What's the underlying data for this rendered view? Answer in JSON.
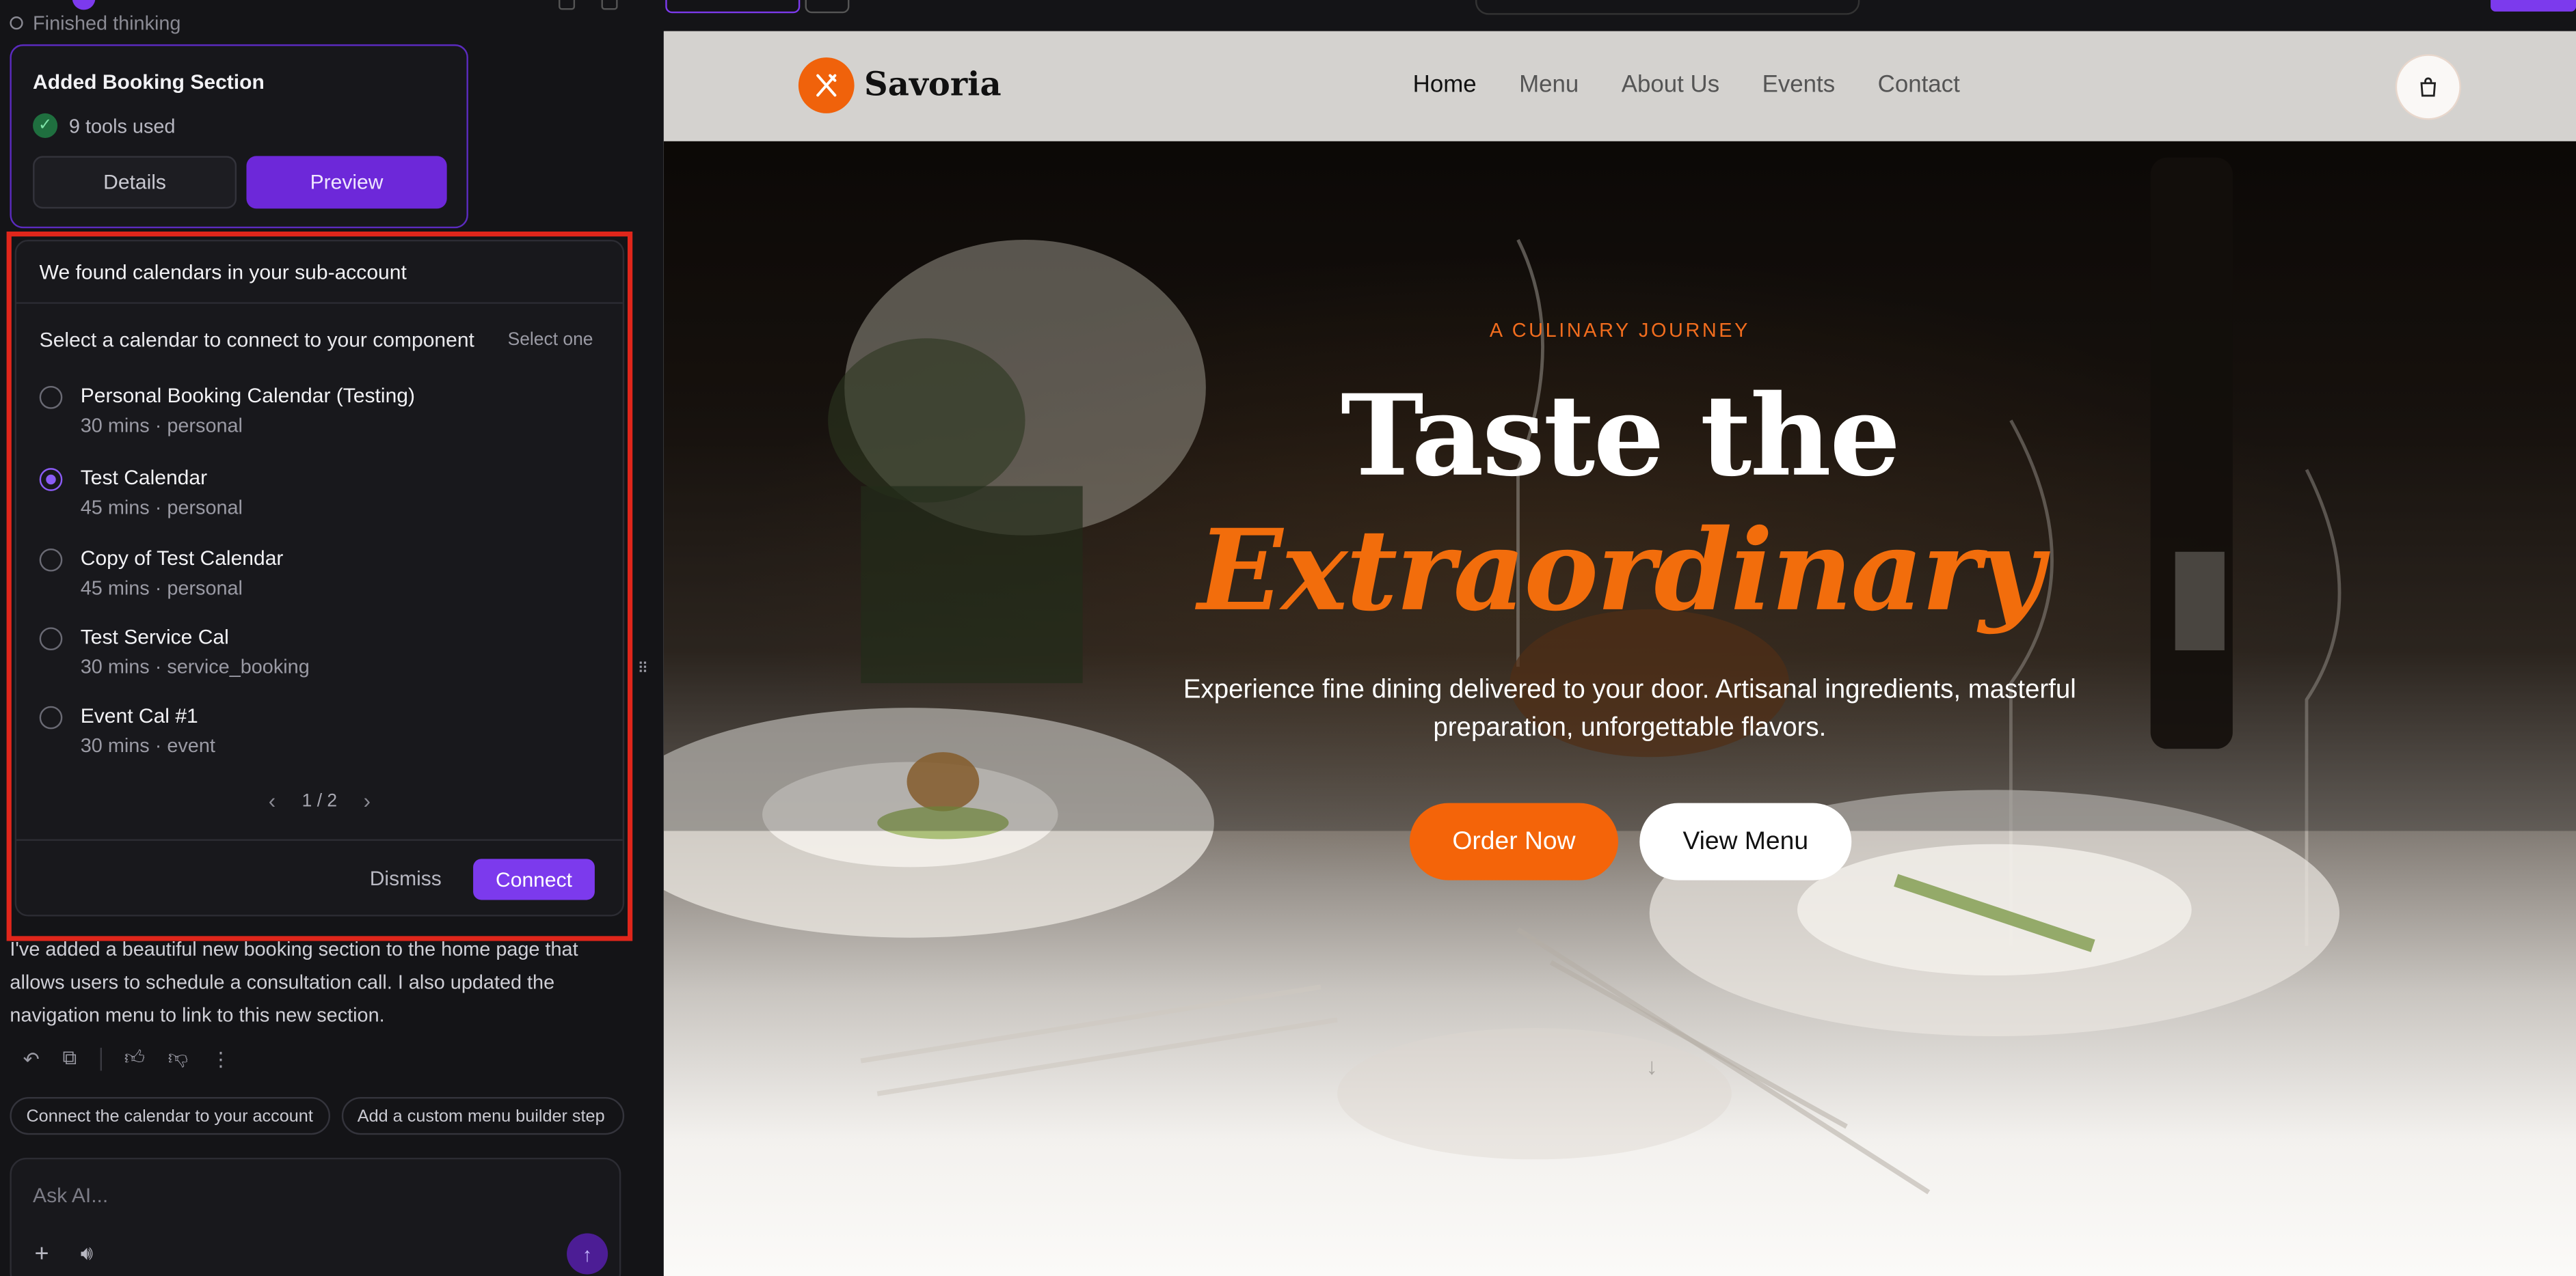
{
  "left": {
    "finished_thinking": "Finished thinking",
    "step": {
      "title": "Added Booking Section",
      "tools": "9 tools used",
      "details": "Details",
      "preview": "Preview"
    },
    "calendar": {
      "header": "We found calendars in your sub-account",
      "subtitle": "Select a calendar to connect to your component",
      "select_hint": "Select one",
      "items": [
        {
          "name": "Personal Booking Calendar (Testing)",
          "meta": "30 mins · personal",
          "selected": false
        },
        {
          "name": "Test Calendar",
          "meta": "45 mins · personal",
          "selected": true
        },
        {
          "name": "Copy of Test Calendar",
          "meta": "45 mins · personal",
          "selected": false
        },
        {
          "name": "Test Service Cal",
          "meta": "30 mins · service_booking",
          "selected": false
        },
        {
          "name": "Event Cal #1",
          "meta": "30 mins · event",
          "selected": false
        }
      ],
      "page": "1 / 2",
      "dismiss": "Dismiss",
      "connect": "Connect"
    },
    "message": "I've added a beautiful new booking section to the home page that allows users to schedule a consultation call. I also updated the navigation menu to link to this new section.",
    "suggestions": [
      "Connect the calendar to your account",
      "Add a custom menu builder step"
    ],
    "input_placeholder": "Ask AI..."
  },
  "site": {
    "brand": "Savoria",
    "nav": [
      "Home",
      "Menu",
      "About Us",
      "Events",
      "Contact"
    ],
    "hero": {
      "eyebrow": "A CULINARY JOURNEY",
      "title_line1": "Taste the",
      "title_line2": "Extraordinary",
      "description": "Experience fine dining delivered to your door. Artisanal ingredients, masterful preparation, unforgettable flavors.",
      "cta_primary": "Order Now",
      "cta_secondary": "View Menu"
    }
  },
  "icons": {
    "check": "check-circle-icon",
    "logo": "utensils-icon",
    "cart": "shopping-bag-icon",
    "scroll": "arrow-down-icon",
    "send": "arrow-up-icon",
    "plus": "plus-icon",
    "voice": "voice-icon"
  },
  "colors": {
    "accent_purple": "#7c3aed",
    "brand_orange": "#f46409",
    "highlight_red": "#e0261b"
  }
}
